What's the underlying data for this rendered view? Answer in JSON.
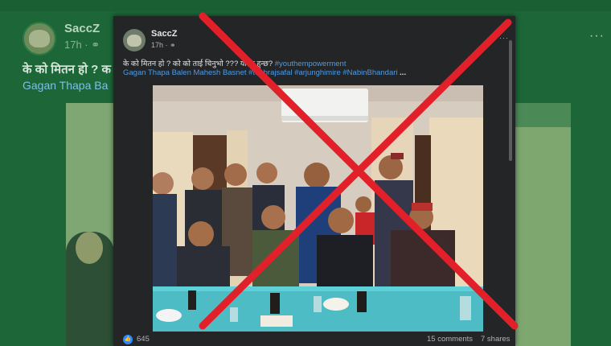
{
  "background_post": {
    "author": "SaccZ",
    "meta": "17h · ",
    "caption": "के को मितन हो ? क",
    "tags": "Gagan Thapa  Ba",
    "more": "···"
  },
  "post": {
    "author": "SaccZ",
    "meta": "17h · ",
    "globe_icon": "globe-icon",
    "more": "···",
    "caption_text": "के को मितन हो ? को को ताई चिनुभो ??? यी के हुन्छ? ",
    "caption_hashtag": "#youthempowerment",
    "tags": "Gagan Thapa  Balen Mahesh Basnet  #toubrajsafal #arjunghimire #NabinBhandari ",
    "tags_more": "...",
    "reactions": {
      "like_icon": "like-icon",
      "likes": "645",
      "comments": "15 comments",
      "shares": "7 shares"
    }
  },
  "overlay": {
    "mark": "red-x",
    "color": "#e2202a"
  }
}
